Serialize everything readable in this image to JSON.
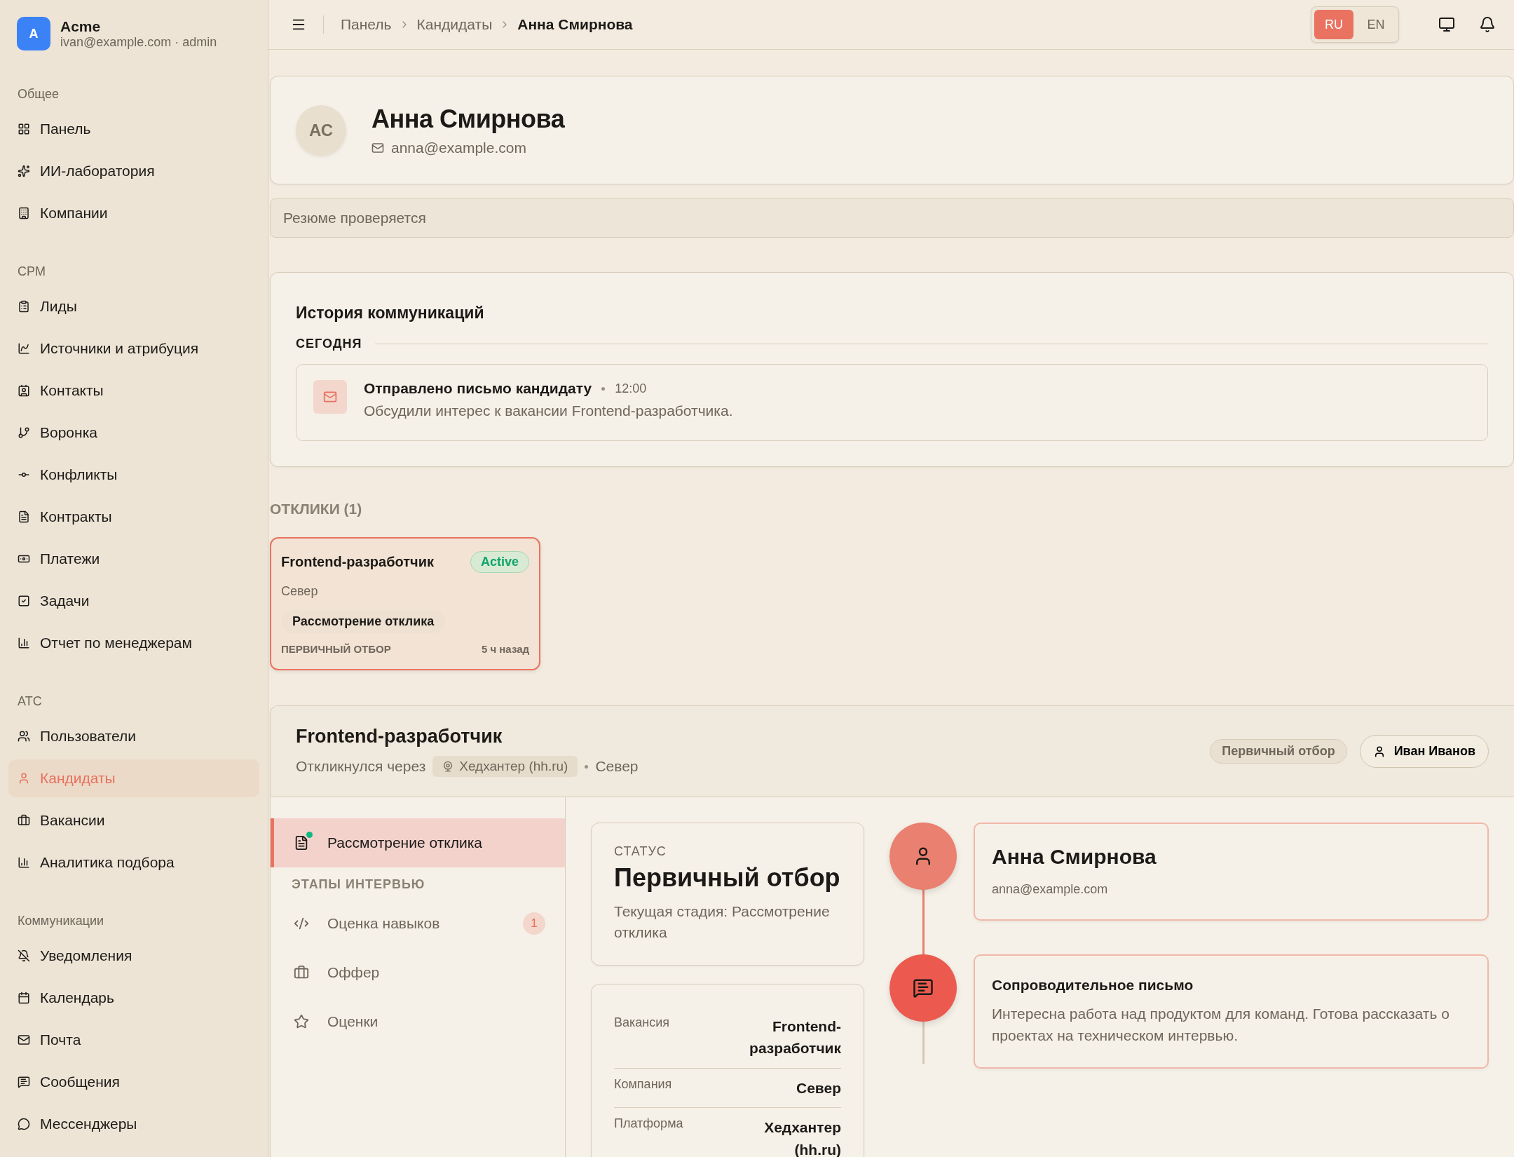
{
  "brand": {
    "logo_letter": "A",
    "name": "Acme",
    "subtitle": "ivan@example.com · admin"
  },
  "sidebar": {
    "sections": [
      {
        "title": "Общее",
        "items": [
          {
            "label": "Панель",
            "selected": false
          },
          {
            "label": "ИИ-лаборатория",
            "selected": false
          },
          {
            "label": "Компании",
            "selected": false
          }
        ]
      },
      {
        "title": "CPM",
        "items": [
          {
            "label": "Лиды",
            "selected": false
          },
          {
            "label": "Источники и атрибуция",
            "selected": false
          },
          {
            "label": "Контакты",
            "selected": false
          },
          {
            "label": "Воронка",
            "selected": false
          },
          {
            "label": "Конфликты",
            "selected": false
          },
          {
            "label": "Контракты",
            "selected": false
          },
          {
            "label": "Платежи",
            "selected": false
          },
          {
            "label": "Задачи",
            "selected": false
          },
          {
            "label": "Отчет по менеджерам",
            "selected": false
          }
        ]
      },
      {
        "title": "ATC",
        "items": [
          {
            "label": "Пользователи",
            "selected": false
          },
          {
            "label": "Кандидаты",
            "selected": true
          },
          {
            "label": "Вакансии",
            "selected": false
          },
          {
            "label": "Аналитика подбора",
            "selected": false
          }
        ]
      },
      {
        "title": "Коммуникации",
        "items": [
          {
            "label": "Уведомления",
            "selected": false
          },
          {
            "label": "Календарь",
            "selected": false
          },
          {
            "label": "Почта",
            "selected": false
          },
          {
            "label": "Сообщения",
            "selected": false
          },
          {
            "label": "Мессенджеры",
            "selected": false
          }
        ]
      }
    ]
  },
  "topbar": {
    "breadcrumbs": [
      "Панель",
      "Кандидаты",
      "Анна Смирнова"
    ],
    "languages": [
      {
        "label": "RU",
        "selected": true
      },
      {
        "label": "EN",
        "selected": false
      }
    ]
  },
  "candidate": {
    "initials": "АС",
    "name": "Анна Смирнова",
    "email": "anna@example.com"
  },
  "status_banner": "Резюме проверяется",
  "history": {
    "title": "История коммуникаций",
    "groups": [
      {
        "label": "СЕГОДНЯ",
        "events": [
          {
            "title": "Отправлено письмо кандидату",
            "time": "12:00",
            "text": "Обсудили интерес к вакансии Frontend-разработчика."
          }
        ]
      }
    ]
  },
  "applications": {
    "title": "ОТКЛИКИ (1)",
    "items": [
      {
        "title": "Frontend-разработчик",
        "badge": "Active",
        "company": "Север",
        "stage": "Рассмотрение отклика",
        "status": "ПЕРВИЧНЫЙ ОТБОР",
        "ago": "5 ч назад",
        "selected": true
      }
    ]
  },
  "application_detail": {
    "title": "Frontend-разработчик",
    "via_label": "Откликнулся через",
    "source": "Хедхантер (hh.ru)",
    "company": "Север",
    "stage_badge": "Первичный отбор",
    "assignee": "Иван Иванов",
    "steps": [
      {
        "label": "Рассмотрение отклика",
        "selected": true
      }
    ],
    "steps_section": "ЭТАПЫ ИНТЕРВЬЮ",
    "interview_steps": [
      {
        "label": "Оценка навыков",
        "count": "1",
        "selected": false
      },
      {
        "label": "Оффер",
        "selected": false
      },
      {
        "label": "Оценки",
        "selected": false
      }
    ],
    "status_card": {
      "caption": "СТАТУС",
      "value": "Первичный отбор",
      "subtitle": "Текущая стадия: Рассмотрение отклика"
    },
    "details": [
      {
        "label": "Вакансия",
        "value": "Frontend-разработчик"
      },
      {
        "label": "Компания",
        "value": "Север"
      },
      {
        "label": "Платформа",
        "value": "Хедхантер (hh.ru)"
      }
    ],
    "timeline": [
      {
        "kind": "profile",
        "title": "Анна Смирнова",
        "text": "anna@example.com"
      },
      {
        "kind": "message",
        "title": "Сопроводительное письмо",
        "text": "Интересна работа над продуктом для команд. Готова рассказать о проектах на техническом интервью."
      }
    ]
  }
}
